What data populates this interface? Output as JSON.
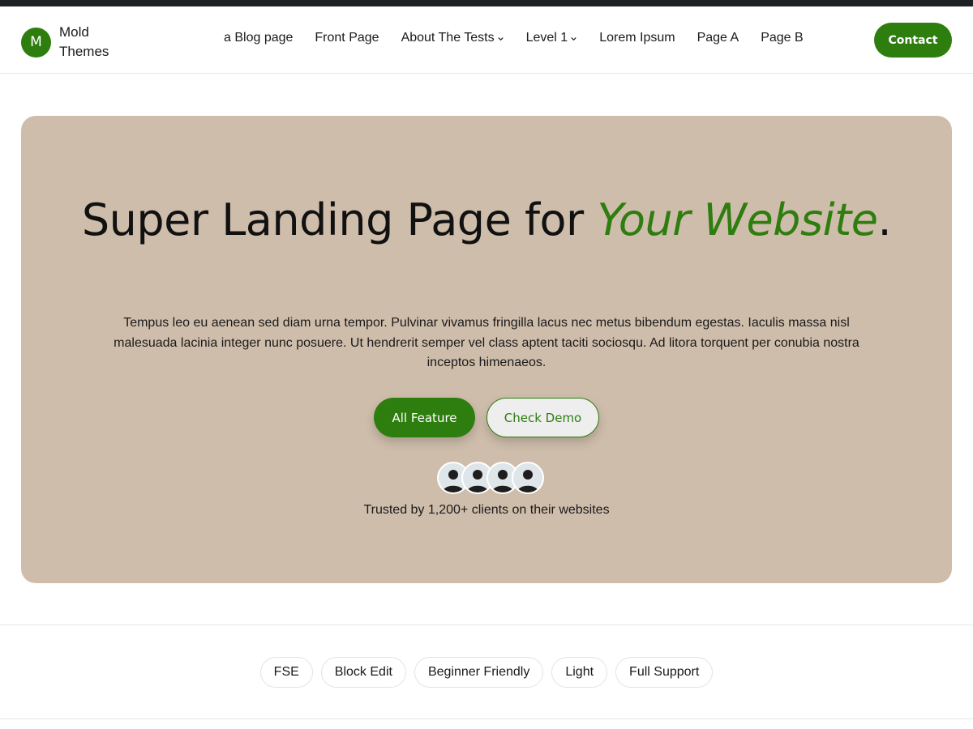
{
  "brand": {
    "initial": "M",
    "name": "Mold Themes"
  },
  "nav": {
    "items": [
      {
        "label": "a Blog page",
        "has_dropdown": false
      },
      {
        "label": "Front Page",
        "has_dropdown": false
      },
      {
        "label": "About The Tests",
        "has_dropdown": true
      },
      {
        "label": "Level 1",
        "has_dropdown": true
      },
      {
        "label": "Lorem Ipsum",
        "has_dropdown": false
      },
      {
        "label": "Page A",
        "has_dropdown": false
      },
      {
        "label": "Page B",
        "has_dropdown": false
      }
    ],
    "contact_label": "Contact"
  },
  "hero": {
    "title_prefix": "Super Landing Page for ",
    "title_accent": "Your Website",
    "title_suffix": ".",
    "description": "Tempus leo eu aenean sed diam urna tempor. Pulvinar vivamus fringilla lacus nec metus bibendum egestas. Iaculis massa nisl malesuada lacinia integer nunc posuere. Ut hendrerit semper vel class aptent taciti sociosqu. Ad litora torquent per conubia nostra inceptos himenaeos.",
    "primary_button": "All Feature",
    "secondary_button": "Check Demo",
    "trusted_text": "Trusted by 1,200+ clients on their websites"
  },
  "tags": [
    "FSE",
    "Block Edit",
    "Beginner Friendly",
    "Light",
    "Full Support"
  ],
  "colors": {
    "accent": "#2e7d0f",
    "hero_background": "#cfbdab",
    "topbar": "#1e2124"
  }
}
